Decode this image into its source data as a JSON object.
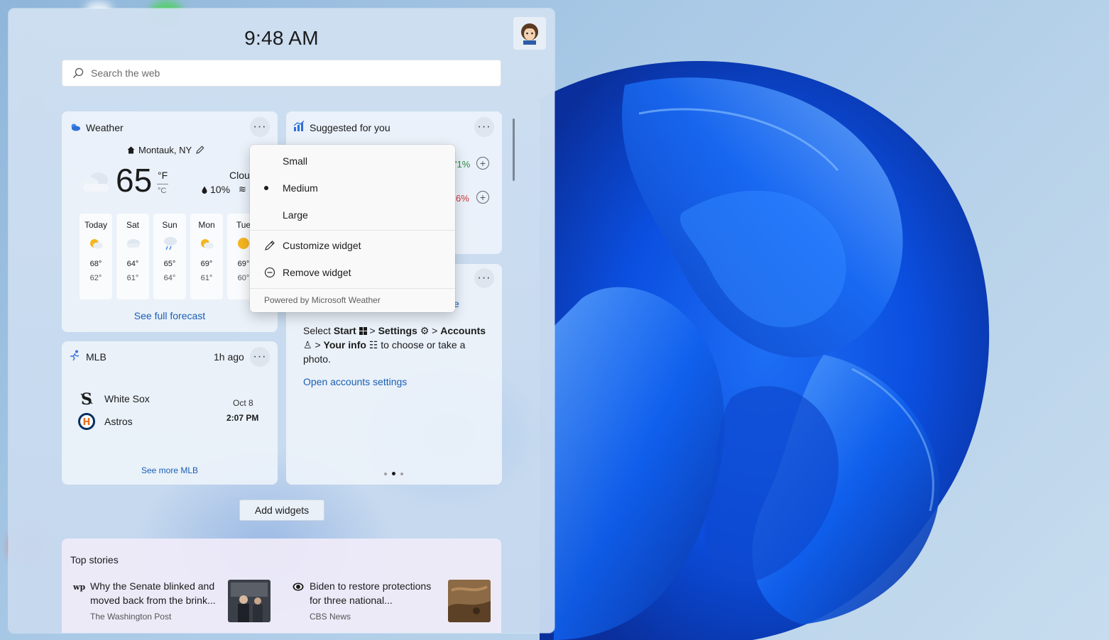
{
  "clock": "9:48 AM",
  "search": {
    "placeholder": "Search the web"
  },
  "weather": {
    "title": "Weather",
    "location": "Montauk, NY",
    "temperature": "65",
    "unit_f": "°F",
    "unit_c": "°C",
    "condition": "Clou",
    "precip": "10%",
    "days": [
      {
        "name": "Today",
        "hi": "68°",
        "lo": "62°",
        "icon": "partly-sunny-icon"
      },
      {
        "name": "Sat",
        "hi": "64°",
        "lo": "61°",
        "icon": "cloudy-icon"
      },
      {
        "name": "Sun",
        "hi": "65°",
        "lo": "64°",
        "icon": "rain-icon"
      },
      {
        "name": "Mon",
        "hi": "69°",
        "lo": "61°",
        "icon": "partly-sunny-icon"
      },
      {
        "name": "Tue",
        "hi": "69°",
        "lo": "60°",
        "icon": "sunny-icon"
      }
    ],
    "forecast_link": "See full forecast"
  },
  "suggested": {
    "title": "Suggested for you",
    "values": [
      "'1%",
      "6%"
    ],
    "value_colors": [
      "#2b8a3e",
      "#d13438"
    ]
  },
  "tips": {
    "text_1": "Select ",
    "start": "Start",
    "sep_1": " > ",
    "settings": "Settings",
    "sep_2": " > ",
    "accounts": "Accounts",
    "sep_3": " > ",
    "your_info": "Your info",
    "text_2": " to choose or take a photo.",
    "link": "Open accounts settings",
    "peek": "e"
  },
  "mlb": {
    "title": "MLB",
    "ago": "1h ago",
    "team_1": "White Sox",
    "team_2": "Astros",
    "date": "Oct 8",
    "time": "2:07 PM",
    "more": "See more MLB"
  },
  "add_widgets": "Add widgets",
  "stories": {
    "title": "Top stories",
    "items": [
      {
        "headline": "Why the Senate blinked and moved back from the brink...",
        "source": "The Washington Post",
        "badge": "wp"
      },
      {
        "headline": "Biden to restore protections for three national...",
        "source": "CBS News"
      }
    ]
  },
  "menu": {
    "size_small": "Small",
    "size_medium": "Medium",
    "size_large": "Large",
    "customize": "Customize widget",
    "remove": "Remove widget",
    "footer": "Powered by Microsoft Weather"
  },
  "colors": {
    "accent": "#1a5fb4",
    "wallpaper_blue": "#0a4ed8"
  }
}
